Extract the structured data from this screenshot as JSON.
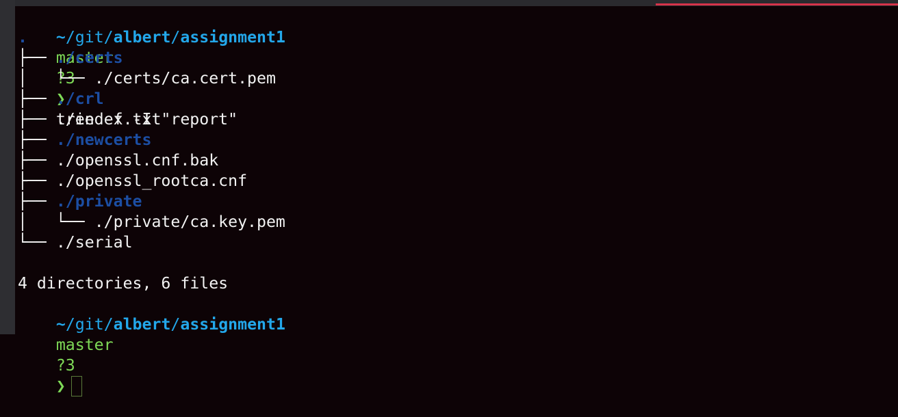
{
  "colors": {
    "background": "#0d0306",
    "path": "#23a7ea",
    "branch": "#7ed957",
    "directory": "#1c4ea3",
    "accent_bar": "#d6334a"
  },
  "prompt": {
    "tilde": "~",
    "sep1": "/",
    "git": "git",
    "sep2": "/",
    "user": "albert",
    "sep3": "/",
    "project": "assignment1",
    "branch": "master",
    "status": "?3",
    "symbol": "❯"
  },
  "command": "tree -f -I \"report\"",
  "tree": {
    "root": ".",
    "entries": [
      {
        "prefix": "├── ",
        "name": "./certs",
        "is_dir": true
      },
      {
        "prefix": "│   └── ",
        "name": "./certs/ca.cert.pem",
        "is_dir": false
      },
      {
        "prefix": "├── ",
        "name": "./crl",
        "is_dir": true
      },
      {
        "prefix": "├── ",
        "name": "./index.txt",
        "is_dir": false
      },
      {
        "prefix": "├── ",
        "name": "./newcerts",
        "is_dir": true
      },
      {
        "prefix": "├── ",
        "name": "./openssl.cnf.bak",
        "is_dir": false
      },
      {
        "prefix": "├── ",
        "name": "./openssl_rootca.cnf",
        "is_dir": false
      },
      {
        "prefix": "├── ",
        "name": "./private",
        "is_dir": true
      },
      {
        "prefix": "│   └── ",
        "name": "./private/ca.key.pem",
        "is_dir": false
      },
      {
        "prefix": "└── ",
        "name": "./serial",
        "is_dir": false
      }
    ]
  },
  "summary": "4 directories, 6 files"
}
